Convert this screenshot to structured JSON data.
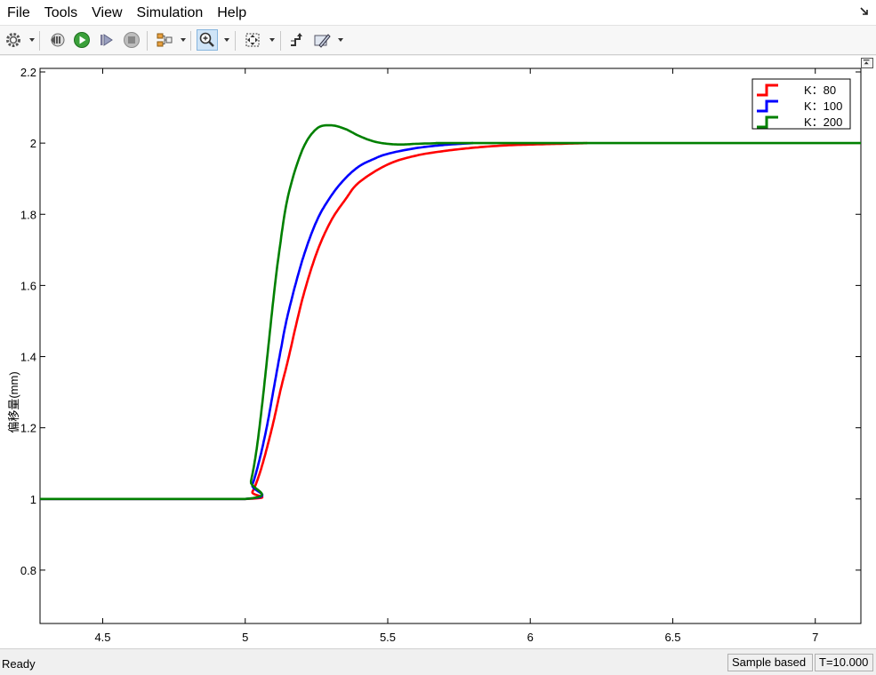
{
  "menubar": {
    "items": [
      "File",
      "Tools",
      "View",
      "Simulation",
      "Help"
    ]
  },
  "toolbar": {
    "buttons": [
      "gear-icon",
      "step-back-icon",
      "run-icon",
      "step-forward-icon",
      "stop-icon",
      "signal-selector-icon",
      "zoom-in-icon",
      "fit-view-icon",
      "cursor-measure-icon",
      "style-edit-icon"
    ]
  },
  "colors": {
    "k80": "#ff0000",
    "k100": "#0000ff",
    "k200": "#008000",
    "axes": "#000000",
    "run_icon": "#3aa03a"
  },
  "chart_data": {
    "type": "line",
    "ylabel": "偏移量(mm)",
    "xlabel": "",
    "title": "",
    "xlim": [
      4.28,
      7.16
    ],
    "ylim": [
      0.65,
      2.21
    ],
    "xticks": [
      "4.5",
      "5",
      "5.5",
      "6",
      "6.5",
      "7"
    ],
    "yticks": [
      "0.8",
      "1",
      "1.2",
      "1.4",
      "1.6",
      "1.8",
      "2",
      "2.2"
    ],
    "xtick_values": [
      4.5,
      5,
      5.5,
      6,
      6.5,
      7
    ],
    "ytick_values": [
      0.8,
      1,
      1.2,
      1.4,
      1.6,
      1.8,
      2,
      2.2
    ],
    "legend_position": "top-right",
    "series": [
      {
        "name": "K：80",
        "color": "#ff0000",
        "x": [
          4.28,
          5.0,
          5.025,
          5.05,
          5.075,
          5.1,
          5.125,
          5.15,
          5.2,
          5.25,
          5.3,
          5.35,
          5.4,
          5.5,
          5.6,
          5.7,
          5.8,
          5.9,
          6.0,
          6.1,
          6.2
        ],
        "y": [
          1.0,
          1.0,
          1.02,
          1.07,
          1.14,
          1.22,
          1.31,
          1.39,
          1.56,
          1.69,
          1.78,
          1.84,
          1.89,
          1.94,
          1.965,
          1.978,
          1.987,
          1.993,
          1.996,
          1.998,
          2.0
        ]
      },
      {
        "name": "K：100",
        "color": "#0000ff",
        "x": [
          4.28,
          5.0,
          5.025,
          5.05,
          5.075,
          5.1,
          5.125,
          5.15,
          5.2,
          5.25,
          5.3,
          5.35,
          5.4,
          5.45,
          5.5,
          5.6,
          5.7,
          5.8
        ],
        "y": [
          1.0,
          1.0,
          1.04,
          1.11,
          1.2,
          1.31,
          1.42,
          1.52,
          1.67,
          1.78,
          1.85,
          1.9,
          1.935,
          1.955,
          1.97,
          1.986,
          1.995,
          2.0
        ]
      },
      {
        "name": "K：200",
        "color": "#008000",
        "x": [
          4.28,
          5.0,
          5.02,
          5.04,
          5.06,
          5.08,
          5.1,
          5.12,
          5.15,
          5.2,
          5.25,
          5.3,
          5.35,
          5.4,
          5.45,
          5.5,
          5.55,
          5.6,
          5.7,
          5.8,
          7.16
        ],
        "y": [
          1.0,
          1.0,
          1.05,
          1.14,
          1.27,
          1.42,
          1.57,
          1.7,
          1.85,
          1.98,
          2.04,
          2.05,
          2.04,
          2.02,
          2.005,
          1.998,
          1.996,
          1.998,
          2.0,
          2.0,
          2.0
        ]
      }
    ]
  },
  "statusbar": {
    "status": "Ready",
    "mode": "Sample based",
    "time": "T=10.000"
  }
}
